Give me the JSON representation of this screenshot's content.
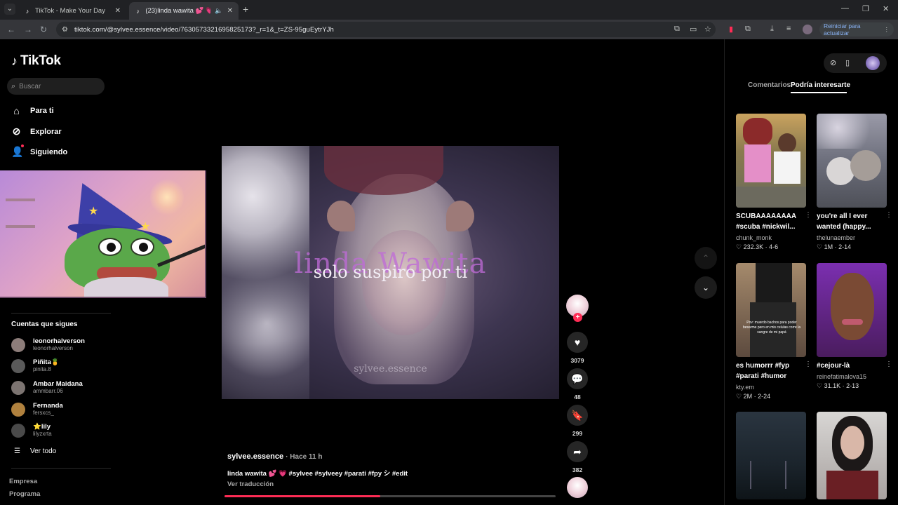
{
  "browser": {
    "tabs": [
      {
        "title": "TikTok - Make Your Day",
        "active": false
      },
      {
        "title": "(23)linda wawita 💕 💗 #sy",
        "active": true
      }
    ],
    "url": "tiktok.com/@sylvee.essence/video/7630573321695825173?_r=1&_t=ZS-95guEytrYJh",
    "restart_label": "Reiniciar para actualizar"
  },
  "sidebar": {
    "logo": "TikTok",
    "search_placeholder": "Buscar",
    "nav": [
      {
        "label": "Para ti",
        "icon": "home-icon"
      },
      {
        "label": "Explorar",
        "icon": "compass-icon"
      },
      {
        "label": "Siguiendo",
        "icon": "following-icon"
      }
    ],
    "following_title": "Cuentas que sigues",
    "accounts": [
      {
        "name": "leonorhalverson",
        "handle": "leonorhalverson",
        "color": "#8d7d7a"
      },
      {
        "name": "Piñita🍍",
        "handle": "pinita.8",
        "color": "#5a5a5a"
      },
      {
        "name": "Ambar Maidana",
        "handle": "ammbarr.06",
        "color": "#7c7471"
      },
      {
        "name": "Fernanda",
        "handle": "fersxcs_",
        "color": "#b0813e"
      },
      {
        "name": "⭐lily",
        "handle": "lilyzxrta",
        "color": "#4a4a4a"
      }
    ],
    "see_all": "Ver todo",
    "footer": [
      "Empresa",
      "Programa"
    ]
  },
  "video": {
    "watermark": "linda Wawita",
    "caption": "solo suspiro por ti",
    "tag": "sylvee.essence",
    "creator": "sylvee.essence",
    "posted": "· Hace 11 h",
    "description": "linda wawita 💕 💗 #sylvee #sylveey #parati #fpy シ #edit",
    "translate": "Ver traducción",
    "progress": 0.47
  },
  "actions": {
    "likes": "3079",
    "comments": "48",
    "saves": "299",
    "shares": "382"
  },
  "right_panel": {
    "tabs": [
      "Comentarios",
      "Podría interesarte"
    ],
    "active_tab": "Podría interesarte",
    "cards": [
      {
        "title": "SCUBAAAAAAAA #scuba #nickwil...",
        "author": "chunk_monk",
        "likes": "232.3K",
        "date": "4-6"
      },
      {
        "title": "you're all I ever wanted (happy...",
        "author": "thelunaember",
        "likes": "1M",
        "date": "2-14"
      },
      {
        "title": "es humorrr #fyp #parati #humor",
        "author": "kty.em",
        "likes": "2M",
        "date": "2-24"
      },
      {
        "title": "#cejour-là",
        "author": "reinefatimalova15",
        "likes": "31.1K",
        "date": "2-13"
      }
    ],
    "thumb_overlay_text": "Pov: muerdo bachos para poder besarme pero en mis celulas corre la sangre de mi papá"
  },
  "colors": {
    "accent": "#fe2c55",
    "background": "#000000"
  }
}
